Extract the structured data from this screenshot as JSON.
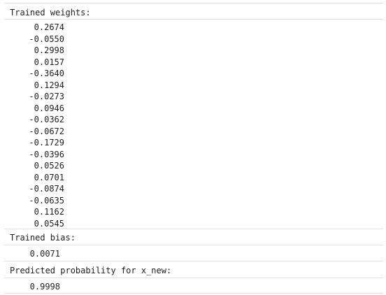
{
  "outputs": [
    {
      "header": "Trained weights:",
      "values": [
        "0.2674",
        "-0.0550",
        "0.2998",
        "0.0157",
        "-0.3640",
        "0.1294",
        "-0.0273",
        "0.0946",
        "-0.0362",
        "-0.0672",
        "-0.1729",
        "-0.0396",
        "0.0526",
        "0.0701",
        "-0.0874",
        "-0.0635",
        "0.1162",
        "0.0545"
      ]
    },
    {
      "header": "Trained bias:",
      "value": "0.0071"
    },
    {
      "header": "Predicted probability for x_new:",
      "value": "0.9998"
    }
  ]
}
